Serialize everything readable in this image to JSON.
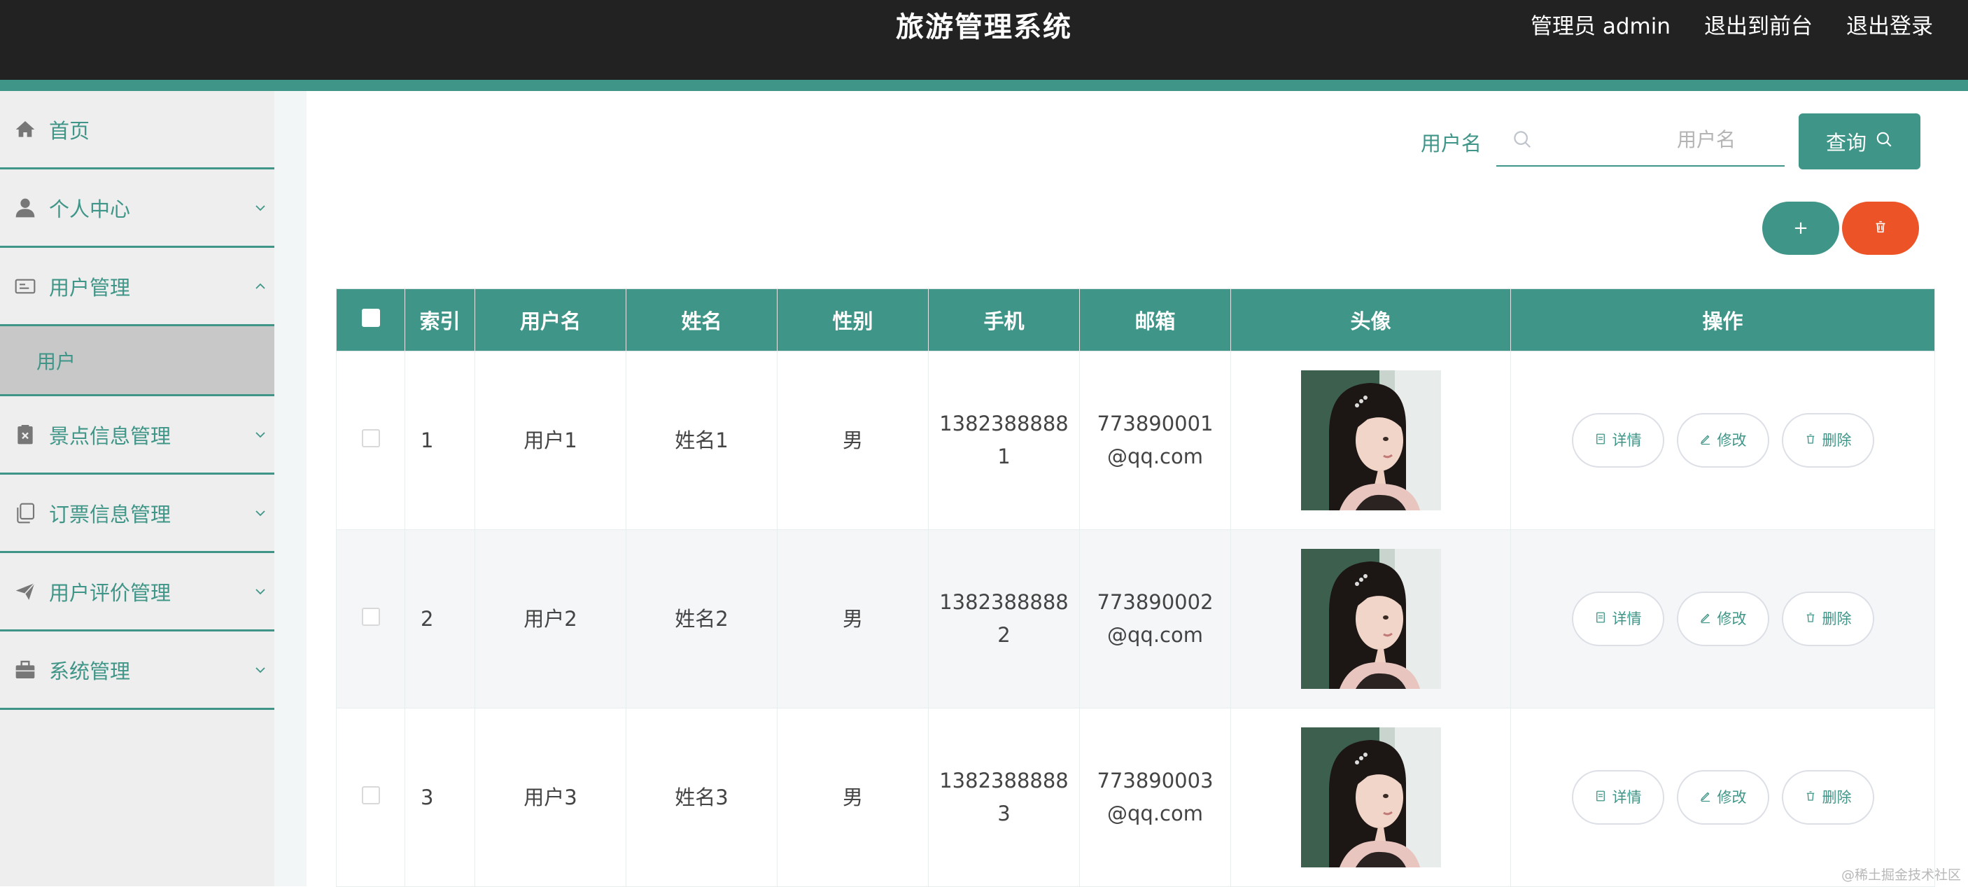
{
  "header": {
    "title": "旅游管理系统",
    "admin_label": "管理员 admin",
    "frontend_link": "退出到前台",
    "logout_link": "退出登录"
  },
  "colors": {
    "accent": "#3f9587",
    "danger": "#ec5326",
    "header_bg": "#222222"
  },
  "sidebar": {
    "items": [
      {
        "label": "首页",
        "icon": "home-icon"
      },
      {
        "label": "个人中心",
        "icon": "user-icon",
        "expanded": false
      },
      {
        "label": "用户管理",
        "icon": "id-card-icon",
        "expanded": true,
        "sub": [
          "用户"
        ]
      },
      {
        "label": "景点信息管理",
        "icon": "clipboard-x-icon",
        "expanded": false
      },
      {
        "label": "订票信息管理",
        "icon": "copy-icon",
        "expanded": false
      },
      {
        "label": "用户评价管理",
        "icon": "paper-plane-icon",
        "expanded": false
      },
      {
        "label": "系统管理",
        "icon": "briefcase-icon",
        "expanded": false
      }
    ],
    "active_sub": "用户"
  },
  "search": {
    "label": "用户名",
    "placeholder": "用户名",
    "value": "",
    "button": "查询"
  },
  "actions": {
    "add": "+",
    "delete_icon": "trash-icon"
  },
  "table": {
    "headers": [
      "",
      "索引",
      "用户名",
      "姓名",
      "性别",
      "手机",
      "邮箱",
      "头像",
      "操作"
    ],
    "rows": [
      {
        "index": "1",
        "username": "用户1",
        "name": "姓名1",
        "gender": "男",
        "phone": "13823888881",
        "email": "773890001@qq.com"
      },
      {
        "index": "2",
        "username": "用户2",
        "name": "姓名2",
        "gender": "男",
        "phone": "13823888882",
        "email": "773890002@qq.com"
      },
      {
        "index": "3",
        "username": "用户3",
        "name": "姓名3",
        "gender": "男",
        "phone": "13823888883",
        "email": "773890003@qq.com"
      }
    ],
    "row_actions": {
      "detail": "详情",
      "edit": "修改",
      "delete": "删除"
    }
  },
  "watermark": "@稀土掘金技术社区"
}
